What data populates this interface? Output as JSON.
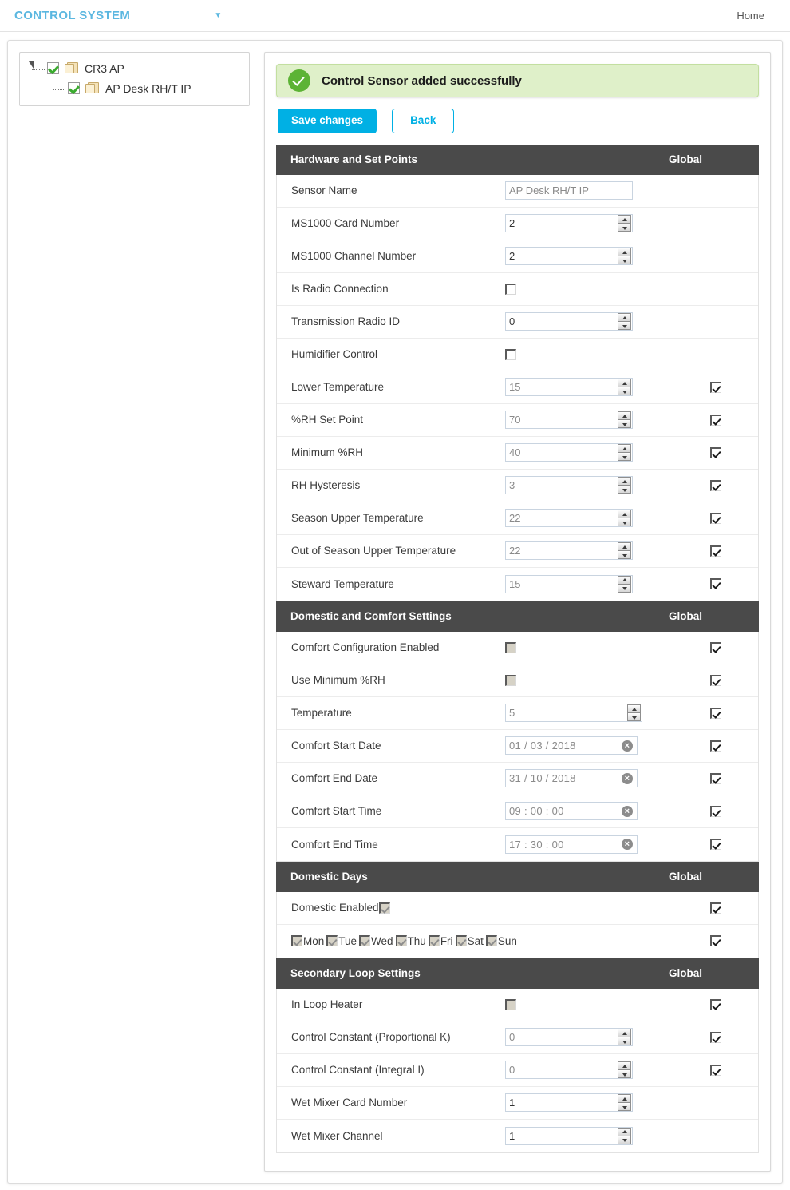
{
  "navbar": {
    "brand": "CONTROL SYSTEM",
    "caret": "▼",
    "home_link": "Home"
  },
  "tree": {
    "nodes": [
      {
        "label": "CR3 AP",
        "checked": true
      },
      {
        "label": "AP Desk RH/T IP",
        "checked": true
      }
    ]
  },
  "alert": {
    "message": "Control Sensor added successfully",
    "color": "#dff0c9",
    "icon": "check-circle-icon"
  },
  "toolbar": {
    "save_label": "Save changes",
    "back_label": "Back",
    "primary_color": "#00b0e4"
  },
  "global_column_label": "Global",
  "sections": [
    {
      "title": "Hardware and Set Points",
      "rows": [
        {
          "label": "Sensor Name",
          "type": "text",
          "value": "AP Desk RH/T IP"
        },
        {
          "label": "MS1000 Card Number",
          "type": "number",
          "value": "2",
          "dark": true
        },
        {
          "label": "MS1000 Channel Number",
          "type": "number",
          "value": "2",
          "dark": true
        },
        {
          "label": "Is Radio Connection",
          "type": "checkbox",
          "checked": false
        },
        {
          "label": "Transmission Radio ID",
          "type": "number",
          "value": "0",
          "dark": true
        },
        {
          "label": "Humidifier Control",
          "type": "checkbox",
          "checked": false
        },
        {
          "label": "Lower Temperature",
          "type": "number",
          "value": "15",
          "global": true
        },
        {
          "label": "%RH Set Point",
          "type": "number",
          "value": "70",
          "global": true
        },
        {
          "label": "Minimum %RH",
          "type": "number",
          "value": "40",
          "global": true
        },
        {
          "label": "RH Hysteresis",
          "type": "number",
          "value": "3",
          "global": true
        },
        {
          "label": "Season Upper Temperature",
          "type": "number",
          "value": "22",
          "global": true
        },
        {
          "label": "Out of Season Upper Temperature",
          "type": "number",
          "value": "22",
          "global": true
        },
        {
          "label": "Steward Temperature",
          "type": "number",
          "value": "15",
          "global": true
        }
      ]
    },
    {
      "title": "Domestic and Comfort Settings",
      "rows": [
        {
          "label": "Comfort Configuration Enabled",
          "type": "checkbox",
          "checked": false,
          "disabled": true,
          "global": true
        },
        {
          "label": "Use Minimum %RH",
          "type": "checkbox",
          "checked": false,
          "disabled": true,
          "global": true
        },
        {
          "label": "Temperature",
          "type": "number",
          "value": "5",
          "wide": true,
          "global": true
        },
        {
          "label": "Comfort Start Date",
          "type": "date",
          "value": "01 / 03 / 2018",
          "global": true
        },
        {
          "label": "Comfort End Date",
          "type": "date",
          "value": "31 / 10 / 2018",
          "global": true
        },
        {
          "label": "Comfort Start Time",
          "type": "date",
          "value": "09 : 00 : 00",
          "global": true
        },
        {
          "label": "Comfort End Time",
          "type": "date",
          "value": "17 : 30 : 00",
          "global": true
        }
      ]
    },
    {
      "title": "Domestic Days",
      "rows": [
        {
          "label": "Domestic Enabled",
          "type": "inline-checkbox",
          "checked": true,
          "disabled": true,
          "global": true
        },
        {
          "label": "",
          "type": "days",
          "global": true,
          "days": [
            {
              "label": "Mon",
              "checked": true
            },
            {
              "label": "Tue",
              "checked": true
            },
            {
              "label": "Wed",
              "checked": true
            },
            {
              "label": "Thu",
              "checked": true
            },
            {
              "label": "Fri",
              "checked": true
            },
            {
              "label": "Sat",
              "checked": true
            },
            {
              "label": "Sun",
              "checked": true
            }
          ]
        }
      ]
    },
    {
      "title": "Secondary Loop Settings",
      "rows": [
        {
          "label": "In Loop Heater",
          "type": "checkbox",
          "checked": false,
          "disabled": true,
          "global": true
        },
        {
          "label": "Control Constant (Proportional K)",
          "type": "number",
          "value": "0",
          "global": true
        },
        {
          "label": "Control Constant (Integral I)",
          "type": "number",
          "value": "0",
          "global": true
        },
        {
          "label": "Wet Mixer Card Number",
          "type": "number",
          "value": "1",
          "dark": true
        },
        {
          "label": "Wet Mixer Channel",
          "type": "number",
          "value": "1",
          "dark": true
        }
      ]
    }
  ]
}
